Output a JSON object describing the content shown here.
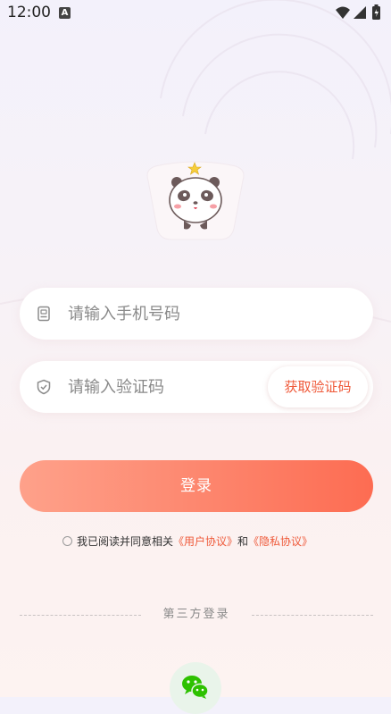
{
  "status_bar": {
    "time": "12:00",
    "notification_badge": "A",
    "icons": [
      "wifi-icon",
      "signal-icon",
      "battery-icon"
    ]
  },
  "logo": {
    "icon": "panda-mascot-icon"
  },
  "phone_field": {
    "icon": "phone-icon",
    "placeholder": "请输入手机号码",
    "value": ""
  },
  "code_field": {
    "icon": "shield-icon",
    "placeholder": "请输入验证码",
    "value": "",
    "get_code_label": "获取验证码"
  },
  "login_button": {
    "label": "登录"
  },
  "agreement": {
    "checked": false,
    "prefix": "我已阅读并同意相关",
    "user_agreement": "《用户协议》",
    "conjunction": "和",
    "privacy_policy": "《隐私协议》"
  },
  "third_party": {
    "label": "第三方登录",
    "providers": [
      {
        "icon": "wechat-icon"
      }
    ]
  },
  "colors": {
    "accent": "#ef5a3a",
    "button_gradient_start": "#fea18a",
    "button_gradient_end": "#fd6c52",
    "wechat_green": "#2dc100"
  }
}
